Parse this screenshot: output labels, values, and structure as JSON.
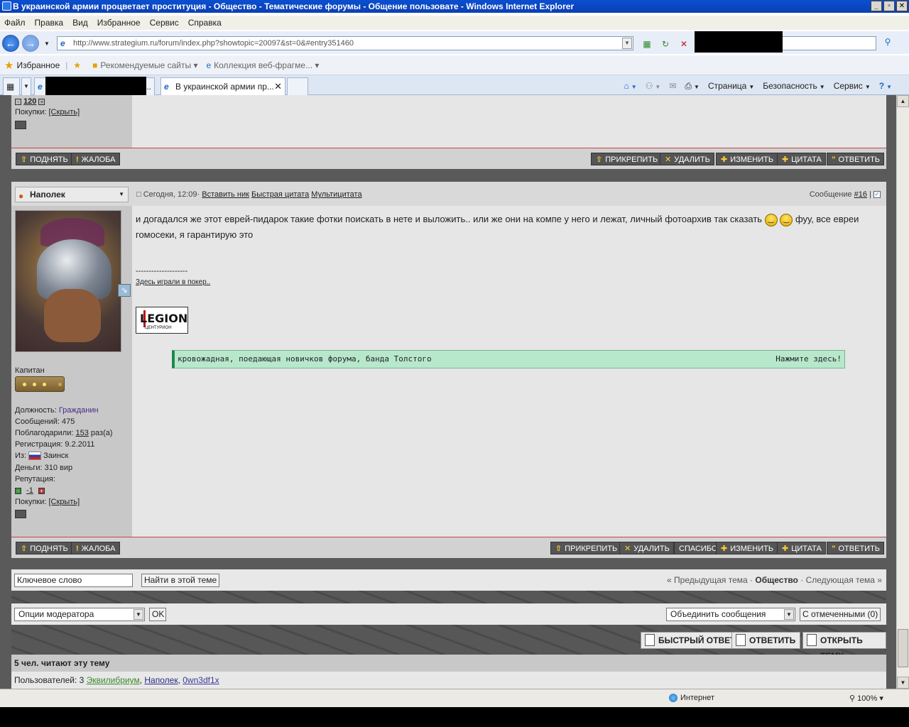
{
  "window": {
    "title": "В украинской армии процветает проституция - Общество - Тематические форумы - Общение пользовате - Windows Internet Explorer",
    "controls": [
      "_",
      "▫",
      "✕"
    ]
  },
  "menu": [
    "Файл",
    "Правка",
    "Вид",
    "Избранное",
    "Сервис",
    "Справка"
  ],
  "address": {
    "url": "http://www.strategium.ru/forum/index.php?showtopic=20097&st=0&#entry351460"
  },
  "favorites": {
    "label": "Избранное",
    "items": [
      "Рекомендуемые сайты",
      "Коллекция веб-фрагме..."
    ]
  },
  "tabs": [
    {
      "label": "..."
    },
    {
      "label": "В украинской армии пр..."
    }
  ],
  "commands": [
    "Страница",
    "Безопасность",
    "Сервис"
  ],
  "prev_post": {
    "rep_value": "120",
    "purchases_label": "Покупки:",
    "purchases_link": "[Скрыть]"
  },
  "post_buttons_top": {
    "left": [
      "ПОДНЯТЬ",
      "ЖАЛОБА"
    ],
    "right": [
      "ПРИКРЕПИТЬ",
      "УДАЛИТЬ",
      "ИЗМЕНИТЬ",
      "ЦИТАТА",
      "ОТВЕТИТЬ"
    ]
  },
  "post": {
    "author": "Наполек",
    "time": "Сегодня, 12:09",
    "actions": [
      "Вставить ник",
      "Быстрая цитата",
      "Мультицитата"
    ],
    "number_label": "Сообщение",
    "number": "#16",
    "text_before": "и догадался же этот еврей-пидарок такие фотки поискать в нете и выложить.. или же они на компе у него и лежат, личный фотоархив так сказать",
    "text_after": "фуу, все евреи гомосеки, я гарантирую это",
    "sig_sep": "--------------------",
    "sig_link": "Здесь играли в покер..",
    "logo_text": "LEGION",
    "logo_sub": "ЦЕНТУРИОН",
    "banner_left": "кровожадная, поедающая новичков форума, банда Толстого",
    "banner_right": "Нажмите здесь!",
    "rank": "Капитан",
    "position_label": "Должность:",
    "position": "Гражданин",
    "messages": "Сообщений: 475",
    "thanks_label": "Поблагодарили:",
    "thanks_count": "153",
    "thanks_suffix": "раз(а)",
    "registered": "Регистрация: 9.2.2011",
    "from_label": "Из:",
    "from": "Заинск",
    "money": "Деньги: 310 вир",
    "reputation_label": "Репутация:",
    "reputation": "-1",
    "purchases_label": "Покупки:",
    "purchases_link": "[Скрыть]"
  },
  "post_buttons_bottom": {
    "left": [
      "ПОДНЯТЬ",
      "ЖАЛОБА"
    ],
    "right": [
      "ПРИКРЕПИТЬ",
      "УДАЛИТЬ",
      "СПАСИБО",
      "ИЗМЕНИТЬ",
      "ЦИТАТА",
      "ОТВЕТИТЬ"
    ]
  },
  "search": {
    "keyword_value": "Ключевое слово",
    "button": "Найти в этой теме",
    "prev_topic": "« Предыдущая тема",
    "forum": "Общество",
    "next_topic": "Следующая тема »"
  },
  "moderation": {
    "options": "Опции модератора",
    "ok": "OK",
    "merge": "Объединить сообщения",
    "selected": "С отмеченными (0)"
  },
  "reply_buttons": [
    "БЫСТРЫЙ ОТВЕТ",
    "ОТВЕТИТЬ",
    "ОТКРЫТЬ ТЕМУ"
  ],
  "readers": {
    "title": "5 чел. читают эту тему",
    "users_label": "Пользователей: 3",
    "users": [
      "Эквилибриум",
      "Наполек",
      "0wn3df1x"
    ]
  },
  "status": {
    "zone": "Интернет",
    "zoom": "100%"
  },
  "colors": {
    "titlebar": "#0b3fb4",
    "post_separator": "#cc4444",
    "banner_bg": "#b8e8cc"
  }
}
